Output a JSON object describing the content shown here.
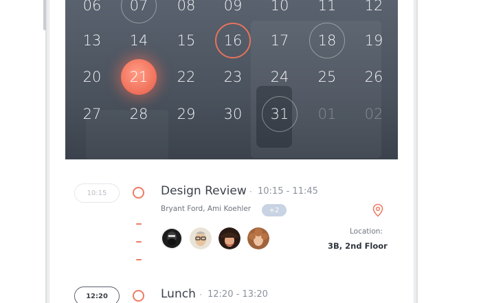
{
  "calendar": {
    "weeks": [
      [
        "06",
        "07",
        "08",
        "09",
        "10",
        "11",
        "12"
      ],
      [
        "13",
        "14",
        "15",
        "16",
        "17",
        "18",
        "19"
      ],
      [
        "20",
        "21",
        "22",
        "23",
        "24",
        "25",
        "26"
      ],
      [
        "27",
        "28",
        "29",
        "30",
        "31",
        "01",
        "02"
      ]
    ],
    "selected_day": "21",
    "highlighted_day": "16",
    "ringed_days": [
      "07",
      "18",
      "31"
    ],
    "next_month_days": [
      "01",
      "02"
    ]
  },
  "events": [
    {
      "time": "10:15",
      "title": "Design Review",
      "separator": "·",
      "range": "10:15 - 11:45",
      "people": "Bryant Ford, Ami Koehler",
      "more_count": "+2",
      "location_label": "Location:",
      "location_value": "3B, 2nd Floor",
      "avatars": [
        "avatar-bearded-man",
        "avatar-man-glasses",
        "avatar-woman-hat",
        "avatar-woman-curly-hair"
      ]
    },
    {
      "time": "12:20",
      "title": "Lunch",
      "separator": "·",
      "range": "12:20 - 13:20"
    }
  ],
  "colors": {
    "accent": "#ef7a63",
    "calendar_bg": "#4a525d",
    "badge": "#c8d3e3"
  },
  "icons": [
    "location-pin-icon"
  ]
}
